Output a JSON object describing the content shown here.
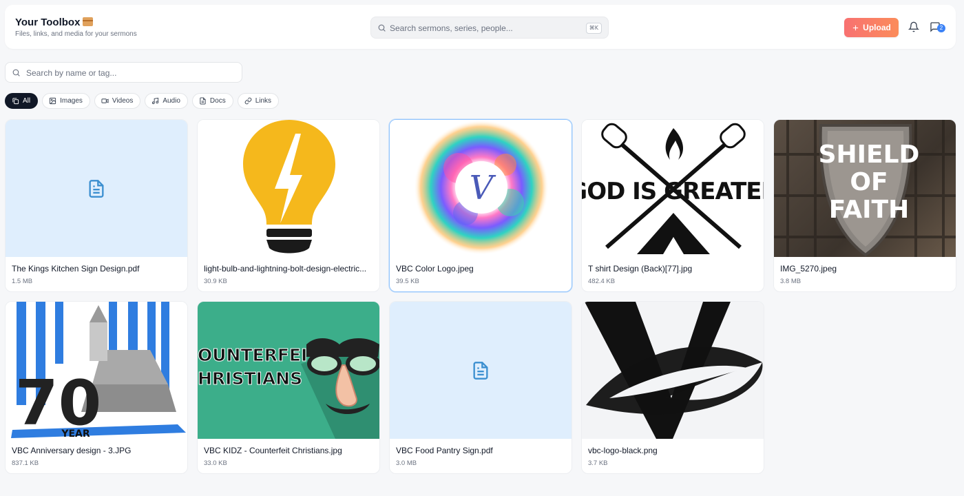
{
  "header": {
    "title": "Your Toolbox",
    "title_icon": "package-emoji",
    "subtitle": "Files, links, and media for your sermons",
    "search_placeholder": "Search sermons, series, people...",
    "search_shortcut": "⌘K",
    "upload_label": "Upload",
    "notifications_icon": "bell-icon",
    "messages_icon": "message-icon",
    "messages_badge": "2"
  },
  "library": {
    "search_placeholder": "Search by name or tag..."
  },
  "filters": [
    {
      "label": "All",
      "icon": "copy-icon",
      "active": true
    },
    {
      "label": "Images",
      "icon": "image-icon",
      "active": false
    },
    {
      "label": "Videos",
      "icon": "video-icon",
      "active": false
    },
    {
      "label": "Audio",
      "icon": "music-icon",
      "active": false
    },
    {
      "label": "Docs",
      "icon": "file-text-icon",
      "active": false
    },
    {
      "label": "Links",
      "icon": "link-icon",
      "active": false
    }
  ],
  "files": [
    {
      "name": "The Kings Kitchen Sign Design.pdf",
      "size": "1.5 MB",
      "kind": "doc"
    },
    {
      "name": "light-bulb-and-lightning-bolt-design-electric...",
      "size": "30.9 KB",
      "kind": "image"
    },
    {
      "name": "VBC Color Logo.jpeg",
      "size": "39.5 KB",
      "kind": "image"
    },
    {
      "name": "T shirt Design (Back)[77].jpg",
      "size": "482.4 KB",
      "kind": "image",
      "thumb_text": "GOD IS GREATER"
    },
    {
      "name": "IMG_5270.jpeg",
      "size": "3.8 MB",
      "kind": "image",
      "thumb_text": [
        "SHIELD",
        "OF",
        "FAITH"
      ]
    },
    {
      "name": "VBC Anniversary design - 3.JPG",
      "size": "837.1 KB",
      "kind": "image",
      "thumb_text": "YEAR"
    },
    {
      "name": "VBC KIDZ - Counterfeit Christians.jpg",
      "size": "33.0 KB",
      "kind": "image",
      "thumb_text": [
        "OUNTERFEIT",
        "HRISTIANS"
      ]
    },
    {
      "name": "VBC Food Pantry Sign.pdf",
      "size": "3.0 MB",
      "kind": "doc"
    },
    {
      "name": "vbc-logo-black.png",
      "size": "3.7 KB",
      "kind": "image"
    }
  ],
  "colors": {
    "accent_upload": "#f87171",
    "doc_thumb_bg": "#dfeefd",
    "doc_icon": "#3b8fd0",
    "active_chip": "#111827",
    "badge": "#3b82f6"
  }
}
